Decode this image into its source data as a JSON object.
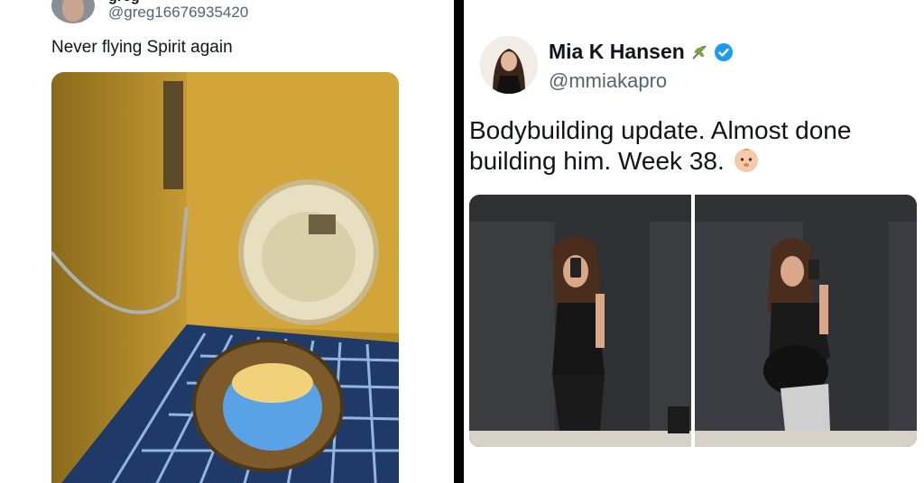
{
  "left_tweet": {
    "display_name": "greg",
    "handle": "@greg16676935420",
    "text": "Never flying Spirit again",
    "photo_icon": "airplane-toilet-photo"
  },
  "right_tweet": {
    "display_name": "Mia K Hansen",
    "name_emoji": "leaf-icon",
    "verified_badge": "verified-icon",
    "handle": "@mmiakapro",
    "text": "Bodybuilding update. Almost done building him. Week 38.",
    "text_emoji": "baby-face-icon",
    "photos": [
      "mirror-selfie-before",
      "mirror-selfie-pregnant"
    ]
  },
  "colors": {
    "divider": "#000000",
    "handle": "#536471",
    "text": "#0f1419",
    "verified": "#1d9bf0"
  }
}
